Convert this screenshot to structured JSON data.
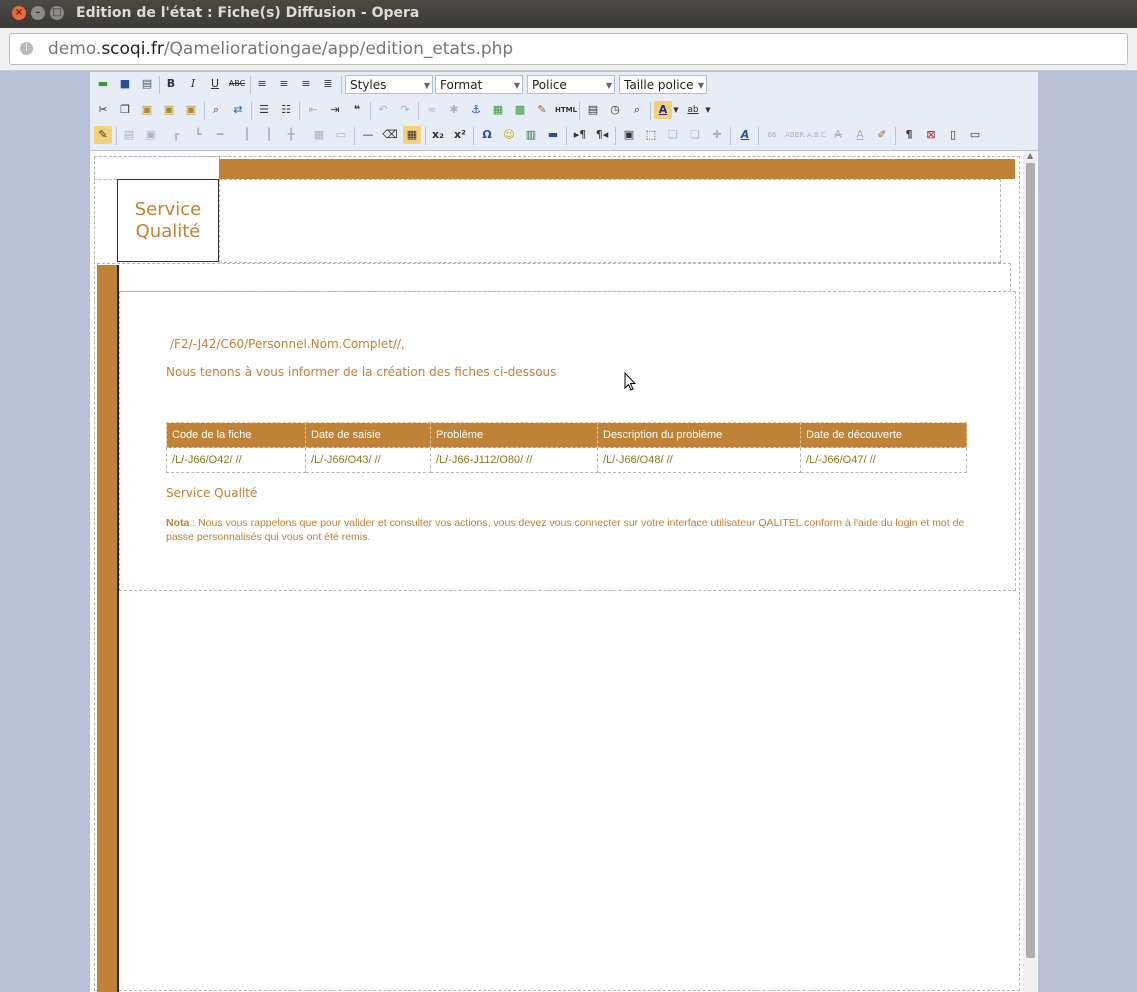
{
  "window": {
    "title": "Edition de l'état : Fiche(s) Diffusion - Opera",
    "close_glyph": "×",
    "minimize_glyph": "–",
    "maximize_glyph": "□"
  },
  "address": {
    "url_prefix": "demo.",
    "url_domain": "scoqi.fr",
    "url_path": "/Qameliorationgae/app/edition_etats.php"
  },
  "toolbar": {
    "styles": "Styles",
    "format": "Format",
    "font": "Police",
    "size": "Taille police",
    "bold": "B",
    "italic": "I",
    "underline": "U",
    "strike": "ABC",
    "html": "HTML",
    "omega": "Ω",
    "pilcrow": "¶"
  },
  "document": {
    "logo_line1": "Service",
    "logo_line2": "Qualité",
    "recipient_line": "/F2/-J42/C60/Personnel.Nom.Complet//,",
    "intro_line": "Nous tenons à vous informer de la création des fiches ci-dessous",
    "table": {
      "headers": [
        "Code de la fiche",
        "Date de saisie",
        "Problème",
        "Description du problème",
        "Date de découverte"
      ],
      "row": [
        "/L/-J66/O42/ //",
        "/L/-J66/O43/ //",
        "/L/-J66-J112/O80/ //",
        "/L/-J66/O48/ //",
        "/L/-J66/O47/ //"
      ]
    },
    "signature": "Service Qualité",
    "nota_label": "Nota",
    "nota_text": " : Nous vous rappelons que pour valider et consulter vos actions, vous devez vous connecter sur votre interface utilisateur QALITEL conform à l'aide du login et mot de passe personnalisés qui vous ont été remis."
  },
  "colors": {
    "accent": "#c08236",
    "table_text": "#8a7a1e"
  }
}
